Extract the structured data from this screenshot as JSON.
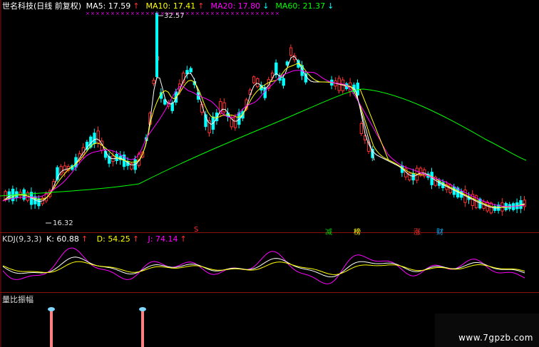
{
  "header": {
    "title": "世名科技(日线 前复权)",
    "ma": [
      {
        "label": "MA5: 17.59",
        "arrow": "↑",
        "color": "#ffffff"
      },
      {
        "label": "MA10: 17.41",
        "arrow": "↑",
        "color": "#ffff00"
      },
      {
        "label": "MA20: 17.80",
        "arrow": "↓",
        "color": "#ff00ff"
      },
      {
        "label": "MA60: 21.37",
        "arrow": "↓",
        "color": "#00ff00"
      }
    ]
  },
  "price_chart": {
    "high_label": "32.57",
    "low_label": "16.32",
    "signals": [
      {
        "text": "S",
        "color": "#ff3030"
      },
      {
        "text": "减",
        "color": "#00d000"
      },
      {
        "text": "榜",
        "color": "#ffff00"
      },
      {
        "text": "涨",
        "color": "#ff3030"
      },
      {
        "text": "财",
        "color": "#00b0ff"
      }
    ]
  },
  "kdj": {
    "title": "KDJ(9,3,3)",
    "k": "K: 60.88",
    "k_arrow": "↑",
    "d": "D: 54.25",
    "d_arrow": "↑",
    "j": "J: 74.14",
    "j_arrow": "↑",
    "colors": {
      "k": "#ffffff",
      "d": "#ffff00",
      "j": "#ff00ff"
    }
  },
  "volume": {
    "title": "量比振幅"
  },
  "watermark": "www.7gpzb.com",
  "colors": {
    "up": "#ff3232",
    "down": "#00ffff",
    "ma5": "#ffffff",
    "ma10": "#ffff00",
    "ma20": "#ff00ff",
    "ma60": "#00ff00",
    "separator": "#8a1010"
  }
}
